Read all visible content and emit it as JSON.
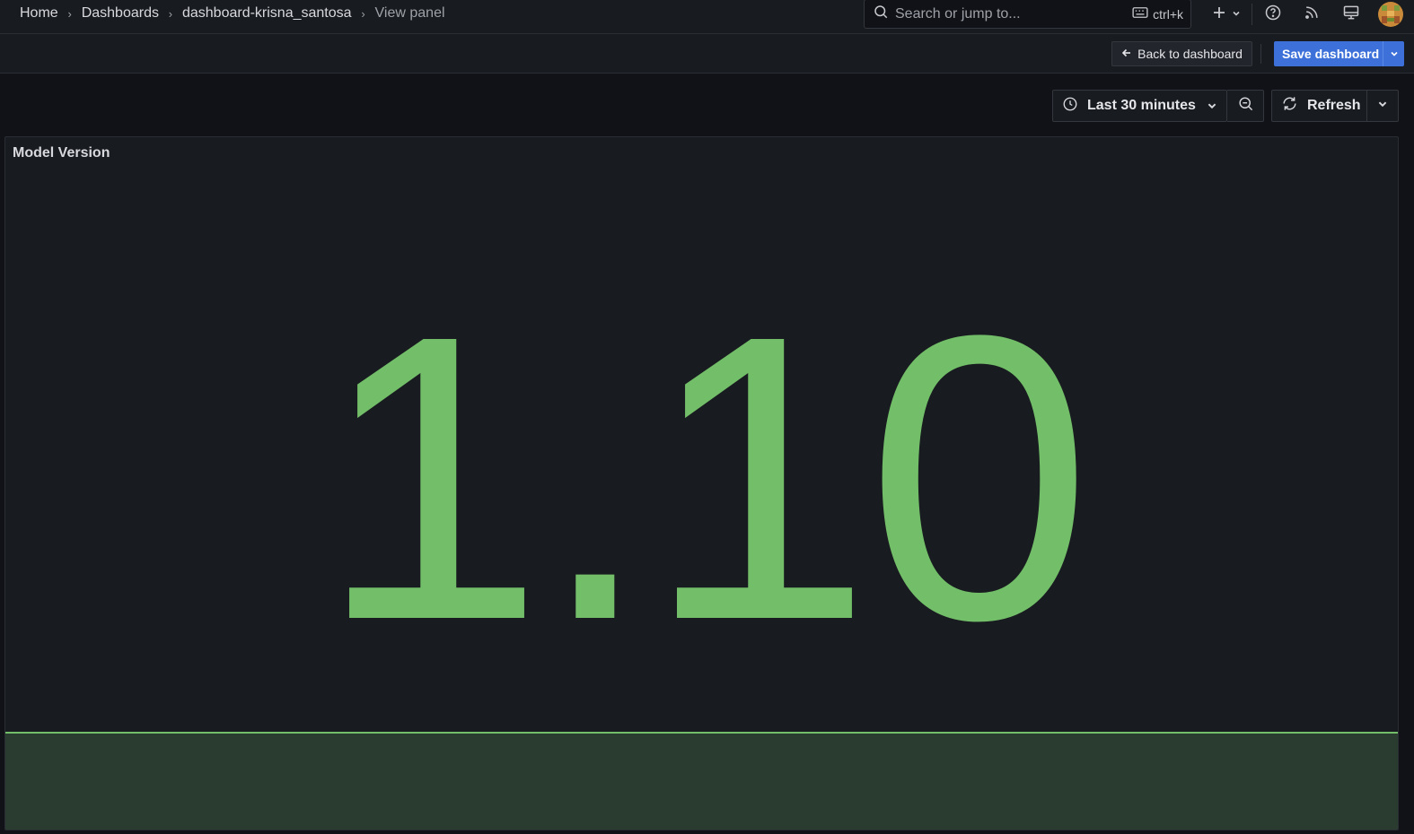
{
  "breadcrumb": {
    "items": [
      "Home",
      "Dashboards",
      "dashboard-krisna_santosa"
    ],
    "current": "View panel"
  },
  "search": {
    "placeholder": "Search or jump to...",
    "shortcut": "ctrl+k"
  },
  "topbar_icons": [
    "plus-icon",
    "help-icon",
    "news-rss-icon",
    "kiosk-monitor-icon"
  ],
  "toolbar": {
    "back_label": "Back to dashboard",
    "save_label": "Save dashboard"
  },
  "time_controls": {
    "range_label": "Last 30 minutes",
    "refresh_label": "Refresh"
  },
  "panel": {
    "title": "Model Version",
    "value": "1.10",
    "value_color": "#73bf69",
    "sparkline_fill": "#2a3c2f",
    "sparkline_line": "#73bf69"
  },
  "colors": {
    "accent": "#3d71d9",
    "background": "#111217",
    "panel_bg": "#181b1f"
  }
}
